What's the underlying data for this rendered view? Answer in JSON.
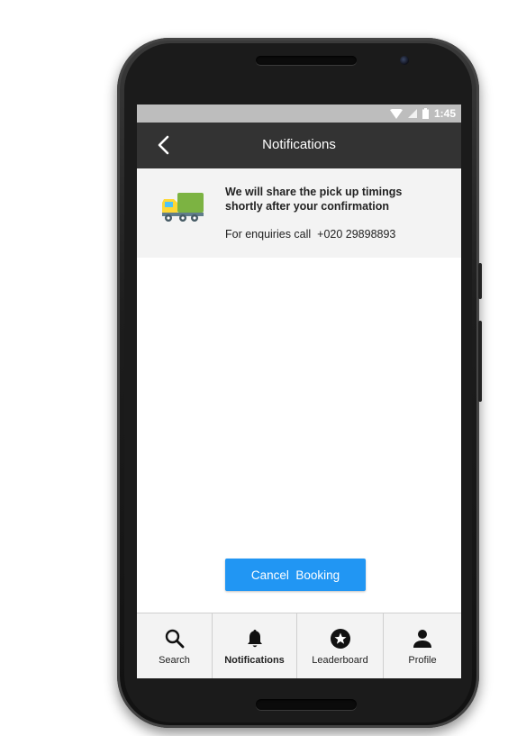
{
  "status_bar": {
    "time": "1:45"
  },
  "app_bar": {
    "title": "Notifications"
  },
  "notification": {
    "message": "We will share the pick up timings shortly after your confirmation",
    "enquiry_label": "For enquiries call",
    "phone": "+020 29898893"
  },
  "actions": {
    "cancel_label": "Cancel  Booking"
  },
  "bottom_nav": {
    "items": [
      {
        "label": "Search",
        "icon": "search-icon"
      },
      {
        "label": "Notifications",
        "icon": "bell-icon",
        "active": true
      },
      {
        "label": "Leaderboard",
        "icon": "star-circle-icon"
      },
      {
        "label": "Profile",
        "icon": "person-icon"
      }
    ]
  },
  "colors": {
    "app_bar": "#333333",
    "primary_button": "#2196f3",
    "status_bar": "#bdbdbd",
    "card_background": "#f3f3f3"
  }
}
